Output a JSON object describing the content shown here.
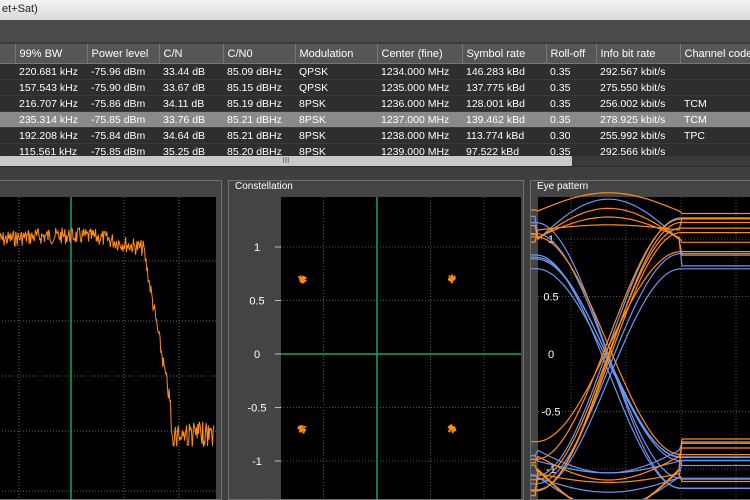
{
  "window": {
    "title": "et+Sat)"
  },
  "table": {
    "columns": [
      "99% BW",
      "Power level",
      "C/N",
      "C/N0",
      "Modulation",
      "Center (fine)",
      "Symbol rate",
      "Roll-off",
      "Info bit rate",
      "Channel code"
    ],
    "rows": [
      [
        "220.681 kHz",
        "-75.96 dBm",
        "33.44 dB",
        "85.09 dBHz",
        "QPSK",
        "1234.000 MHz",
        "146.283 kBd",
        "0.35",
        "292.567 kbit/s",
        ""
      ],
      [
        "157.543 kHz",
        "-75.90 dBm",
        "33.67 dB",
        "85.15 dBHz",
        "QPSK",
        "1235.000 MHz",
        "137.775 kBd",
        "0.35",
        "275.550 kbit/s",
        ""
      ],
      [
        "216.707 kHz",
        "-75.86 dBm",
        "34.11 dB",
        "85.19 dBHz",
        "8PSK",
        "1236.000 MHz",
        "128.001 kBd",
        "0.35",
        "256.002 kbit/s",
        "TCM"
      ],
      [
        "235.314 kHz",
        "-75.85 dBm",
        "33.76 dB",
        "85.21 dBHz",
        "8PSK",
        "1237.000 MHz",
        "139.462 kBd",
        "0.35",
        "278.925 kbit/s",
        "TCM"
      ],
      [
        "192.208 kHz",
        "-75.84 dBm",
        "34.64 dB",
        "85.21 dBHz",
        "8PSK",
        "1238.000 MHz",
        "113.774 kBd",
        "0.30",
        "255.992 kbit/s",
        "TPC"
      ],
      [
        "115.561 kHz",
        "-75.85 dBm",
        "35.25 dB",
        "85.20 dBHz",
        "8PSK",
        "1239.000 MHz",
        "97.522 kBd",
        "0.35",
        "292.566 kbit/s",
        ""
      ]
    ],
    "selected_row": 3
  },
  "scrollbar": {
    "grip": "III"
  },
  "constellation": {
    "title": "Constellation",
    "ticks_y": [
      "1",
      "0.5",
      "0",
      "-0.5",
      "-1"
    ],
    "points": [
      [
        -0.7,
        0.7
      ],
      [
        0.7,
        0.7
      ],
      [
        -0.7,
        -0.7
      ],
      [
        0.7,
        -0.7
      ]
    ]
  },
  "eye": {
    "title": "Eye pattern",
    "ticks_y": [
      "1",
      "0.5",
      "0",
      "-0.5",
      "-1"
    ]
  },
  "colors": {
    "orange": "#ff8c1a",
    "blue": "#6f95f0",
    "grid_green": "#0fa86b"
  }
}
